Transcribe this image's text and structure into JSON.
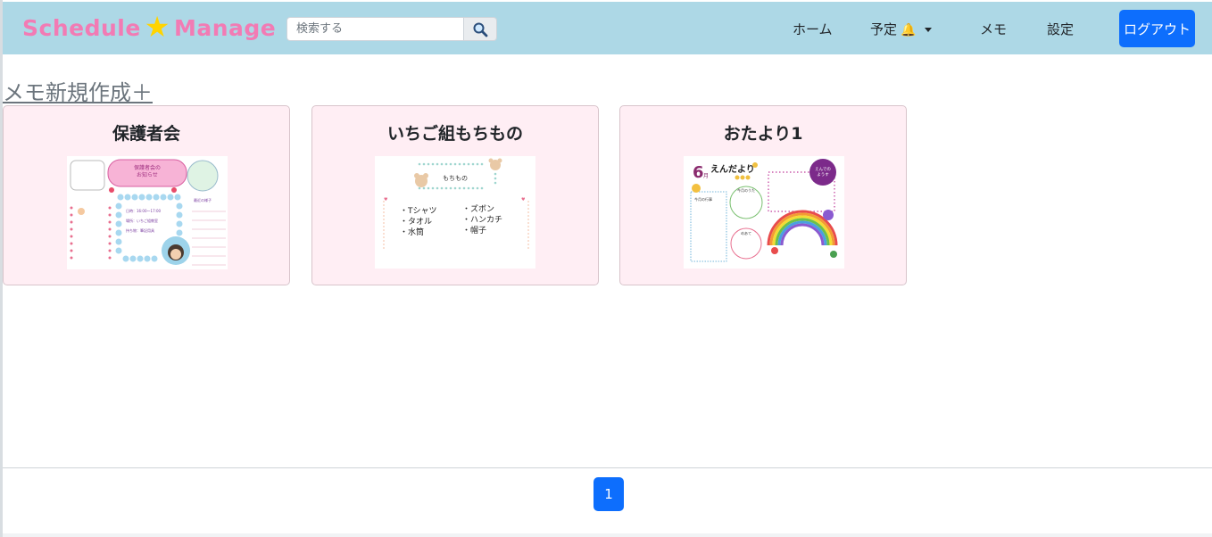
{
  "header": {
    "brand_left": "Schedule",
    "brand_star": "★",
    "brand_right": "Manage",
    "search_placeholder": "検索する",
    "search_icon": "magnifier-icon",
    "nav": {
      "home": "ホーム",
      "schedule": "予定",
      "schedule_icon": "bell-icon",
      "memo": "メモ",
      "settings": "設定",
      "logout": "ログアウト"
    }
  },
  "main": {
    "new_memo_link": "メモ新規作成＋",
    "cards": [
      {
        "title": "保護者会",
        "thumb": {
          "heading": "保護者会の\nお知らせ",
          "line1": "日時：16:00〜17:00",
          "line2": "場所：いちご組教室",
          "line3": "持ち物：筆記用具",
          "side": "最近の様子"
        }
      },
      {
        "title": "いちご組もちもの",
        "thumb": {
          "heading": "もちもの",
          "items": [
            "・Tシャツ",
            "・タオル",
            "・水筒",
            "・ズボン",
            "・ハンカチ",
            "・帽子"
          ]
        }
      },
      {
        "title": "おたより1",
        "thumb": {
          "month": "6",
          "month_suffix": "月",
          "heading": "えんだより",
          "badge": "えんでのようす"
        }
      }
    ]
  },
  "pagination": {
    "current": "1"
  },
  "colors": {
    "navbar": "#add8e6",
    "brand": "#f27bb4",
    "star": "#ffd400",
    "primary": "#0d6efd",
    "card_bg": "#ffeef4"
  }
}
